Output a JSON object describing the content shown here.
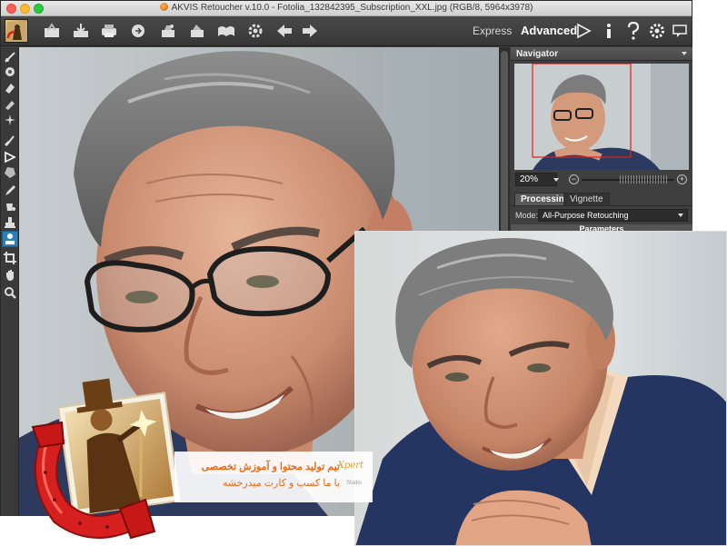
{
  "window": {
    "title": "AKVIS Retoucher v.10.0 - Fotolia_132842395_Subscription_XXL.jpg (RGB/8, 5964x3978)"
  },
  "toolbar": {
    "buttons": [
      "open-icon",
      "save-icon",
      "print-icon",
      "share-icon",
      "batch-icon",
      "preferences-icon",
      "help-icon",
      "settings-icon",
      "undo-icon",
      "redo-icon"
    ],
    "mode_express": "Express",
    "mode_advanced": "Advanced",
    "right_icons": [
      "run-icon",
      "info-icon",
      "help-icon",
      "settings-icon",
      "message-icon"
    ]
  },
  "left_tools": [
    "retouch-brush-icon",
    "clone-icon",
    "eraser-icon",
    "patch-icon",
    "heal-icon",
    "brush-icon",
    "selection-icon",
    "polygon-icon",
    "pencil-icon",
    "bucket-icon",
    "stamp-icon",
    "blur-icon",
    "crop-icon",
    "hand-icon",
    "zoom-icon"
  ],
  "navigator": {
    "title": "Navigator",
    "zoom": "20%"
  },
  "tabs": {
    "processing": "Processing",
    "vignette": "Vignette"
  },
  "mode": {
    "label": "Mode:",
    "value": "All-Purpose Retouching"
  },
  "parameters_title": "Parameters",
  "watermark": {
    "line1": "تیم تولید محتوا و آموزش تخصصی",
    "line2": "با ما کسب و کارت میدرخشه",
    "brand": "Xpert",
    "brand_sub": "Studio"
  },
  "colors": {
    "accent_orange": "#e86a1a",
    "panel_dark": "#3c3c3c",
    "navigator_frame": "#e02020"
  }
}
